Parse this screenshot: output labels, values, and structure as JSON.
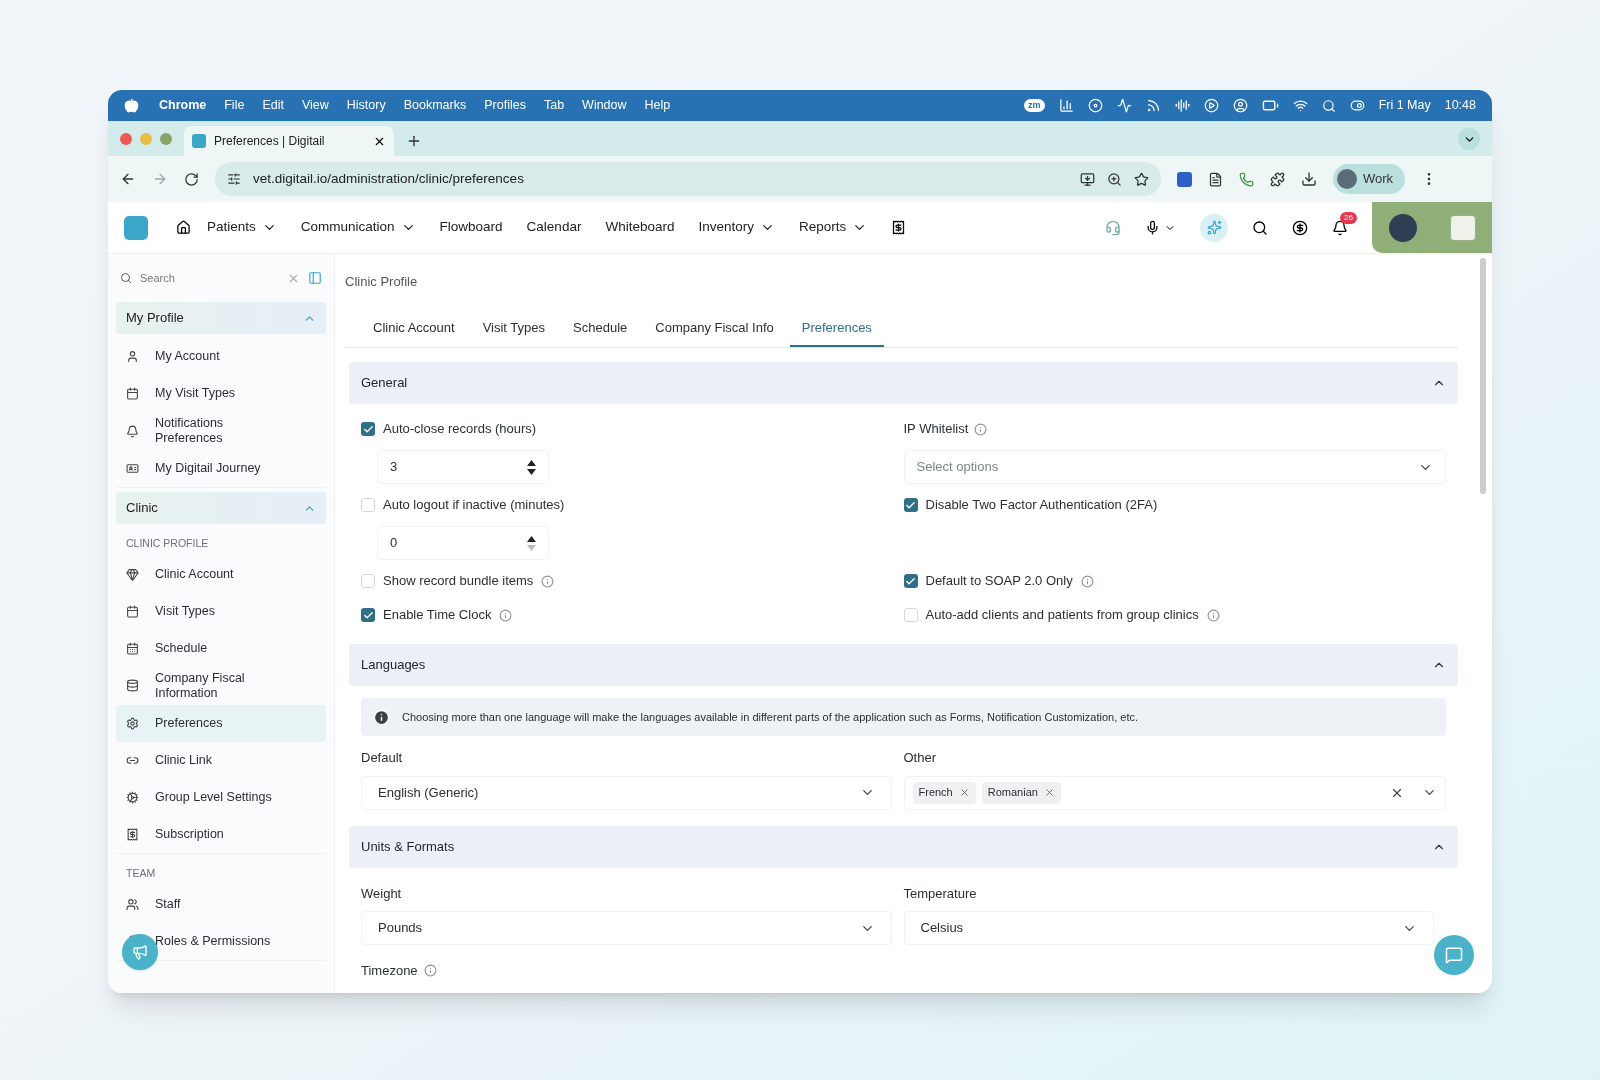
{
  "menubar": {
    "app": "Chrome",
    "items": [
      "File",
      "Edit",
      "View",
      "History",
      "Bookmarks",
      "Profiles",
      "Tab",
      "Window",
      "Help"
    ],
    "zoom_badge": "zm",
    "date": "Fri 1 May",
    "time": "10:48"
  },
  "browser": {
    "tab_title": "Preferences | Digitail",
    "url": "vet.digitail.io/administration/clinic/preferences",
    "profile": "Work"
  },
  "nav": {
    "items": [
      {
        "label": "Patients",
        "has_menu": true
      },
      {
        "label": "Communication",
        "has_menu": true
      },
      {
        "label": "Flowboard",
        "has_menu": false
      },
      {
        "label": "Calendar",
        "has_menu": false
      },
      {
        "label": "Whiteboard",
        "has_menu": false
      },
      {
        "label": "Inventory",
        "has_menu": true
      },
      {
        "label": "Reports",
        "has_menu": true
      }
    ],
    "notification_count": "26"
  },
  "sidebar": {
    "search": {
      "placeholder": "Search"
    },
    "sections": [
      {
        "title": "My Profile",
        "expanded": true,
        "groups": [
          {
            "items": [
              {
                "label": "My Account",
                "selected": false
              },
              {
                "label": "My Visit Types",
                "selected": false
              },
              {
                "label": "Notifications Preferences",
                "selected": false
              },
              {
                "label": "My Digitail Journey",
                "selected": false
              }
            ]
          }
        ]
      },
      {
        "title": "Clinic",
        "expanded": true,
        "groups": [
          {
            "heading": "CLINIC PROFILE",
            "items": [
              {
                "label": "Clinic Account",
                "selected": false
              },
              {
                "label": "Visit Types",
                "selected": false
              },
              {
                "label": "Schedule",
                "selected": false
              },
              {
                "label": "Company Fiscal Information",
                "selected": false
              },
              {
                "label": "Preferences",
                "selected": true
              },
              {
                "label": "Clinic Link",
                "selected": false
              },
              {
                "label": "Group Level Settings",
                "selected": false
              },
              {
                "label": "Subscription",
                "selected": false
              }
            ]
          },
          {
            "heading": "TEAM",
            "items": [
              {
                "label": "Staff",
                "selected": false
              },
              {
                "label": "Roles & Permissions",
                "selected": false
              }
            ]
          }
        ]
      }
    ]
  },
  "breadcrumb": "Clinic Profile",
  "tabs": [
    {
      "label": "Clinic Account",
      "selected": false
    },
    {
      "label": "Visit Types",
      "selected": false
    },
    {
      "label": "Schedule",
      "selected": false
    },
    {
      "label": "Company Fiscal Info",
      "selected": false
    },
    {
      "label": "Preferences",
      "selected": true
    }
  ],
  "general": {
    "title": "General",
    "expanded": true,
    "rows": [
      {
        "left": {
          "kind": "checkbox",
          "label": "Auto-close records (hours)",
          "checked": true,
          "info": false
        },
        "right": {
          "kind": "label",
          "label": "IP Whitelist",
          "info": true
        }
      },
      {
        "left": {
          "kind": "number",
          "value": "3",
          "down_disabled": false
        },
        "right": {
          "kind": "select",
          "placeholder": "Select options"
        }
      },
      {
        "left": {
          "kind": "checkbox",
          "label": "Auto logout if inactive (minutes)",
          "checked": false,
          "info": false
        },
        "right": {
          "kind": "checkbox",
          "label": "Disable Two Factor Authentication (2FA)",
          "checked": true,
          "info": false
        }
      },
      {
        "left": {
          "kind": "number",
          "value": "0",
          "down_disabled": true
        }
      },
      {
        "left": {
          "kind": "checkbox",
          "label": "Show record bundle items",
          "checked": false,
          "info": true
        },
        "right": {
          "kind": "checkbox",
          "label": "Default to SOAP 2.0 Only",
          "checked": true,
          "info": true
        }
      },
      {
        "left": {
          "kind": "checkbox",
          "label": "Enable Time Clock",
          "checked": true,
          "info": true
        },
        "right": {
          "kind": "checkbox",
          "label": "Auto-add clients and patients from group clinics",
          "checked": false,
          "info": true
        }
      }
    ]
  },
  "languages": {
    "title": "Languages",
    "expanded": true,
    "notice": "Choosing more than one language will make the languages available in different parts of the application such as Forms, Notification Customization, etc.",
    "default": {
      "label": "Default",
      "value": "English (Generic)"
    },
    "other": {
      "label": "Other",
      "tags": [
        "French",
        "Romanian"
      ]
    }
  },
  "units": {
    "title": "Units & Formats",
    "expanded": true,
    "weight": {
      "label": "Weight",
      "value": "Pounds"
    },
    "temperature": {
      "label": "Temperature",
      "value": "Celsius"
    },
    "timezone": {
      "label": "Timezone",
      "info": true
    }
  }
}
